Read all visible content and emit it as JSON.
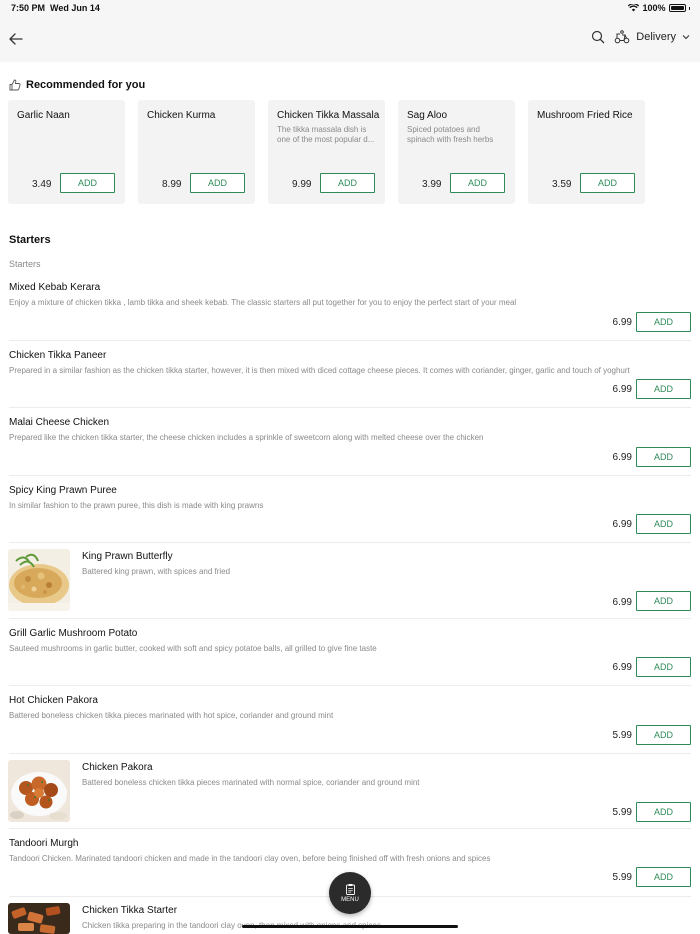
{
  "status": {
    "time": "7:50 PM",
    "date": "Wed Jun 14",
    "battery": "100%"
  },
  "nav": {
    "delivery_label": "Delivery"
  },
  "recommended": {
    "title": "Recommended for you",
    "items": [
      {
        "name": "Garlic Naan",
        "desc": "",
        "price": "3.49",
        "add": "ADD"
      },
      {
        "name": "Chicken Kurma",
        "desc": "",
        "price": "8.99",
        "add": "ADD"
      },
      {
        "name": "Chicken Tikka Massala",
        "desc": "The tikka massala dish is one of the most popular d...",
        "price": "9.99",
        "add": "ADD"
      },
      {
        "name": "Sag Aloo",
        "desc": "Spiced potatoes and spinach with fresh herbs",
        "price": "3.99",
        "add": "ADD"
      },
      {
        "name": "Mushroom Fried Rice",
        "desc": "",
        "price": "3.59",
        "add": "ADD"
      }
    ]
  },
  "starters": {
    "title": "Starters",
    "subtitle": "Starters",
    "items": [
      {
        "name": "Mixed Kebab Kerara",
        "desc": "Enjoy a mixture of chicken tikka , lamb tikka and sheek kebab. The classic starters all put together for you to enjoy the perfect start of your meal",
        "price": "6.99",
        "add": "ADD"
      },
      {
        "name": "Chicken Tikka Paneer",
        "desc": "Prepared in a similar fashion as the chicken tikka starter, however, it is then mixed with diced cottage cheese pieces. It comes with coriander, ginger, garlic and touch of yoghurt",
        "price": "6.99",
        "add": "ADD"
      },
      {
        "name": "Malai Cheese Chicken",
        "desc": "Prepared like the chicken tikka starter, the cheese chicken includes a sprinkle of sweetcorn along with melted cheese over the chicken",
        "price": "6.99",
        "add": "ADD"
      },
      {
        "name": "Spicy King Prawn Puree",
        "desc": "In similar fashion to the prawn puree, this dish is made with king prawns",
        "price": "6.99",
        "add": "ADD"
      },
      {
        "name": "King Prawn Butterfly",
        "desc": "Battered king prawn, with spices and fried",
        "price": "6.99",
        "add": "ADD"
      },
      {
        "name": "Grill Garlic Mushroom Potato",
        "desc": "Sauteed mushrooms in garlic butter, cooked with soft and spicy potatoe balls, all grilled to give fine taste",
        "price": "6.99",
        "add": "ADD"
      },
      {
        "name": "Hot Chicken Pakora",
        "desc": "Battered boneless chicken tikka pieces marinated with hot spice, coriander and ground mint",
        "price": "5.99",
        "add": "ADD"
      },
      {
        "name": "Chicken Pakora",
        "desc": "Battered boneless chicken tikka pieces marinated with normal spice, coriander and ground mint",
        "price": "5.99",
        "add": "ADD"
      },
      {
        "name": "Tandoori Murgh",
        "desc": "Tandoori Chicken. Marinated tandoori chicken and made in the tandoori clay oven, before being finished off with fresh onions and spices",
        "price": "5.99",
        "add": "ADD"
      },
      {
        "name": "Chicken Tikka Starter",
        "desc": "Chicken tikka preparing in the tandoori clay oven, then mixed with onions and spices"
      }
    ]
  },
  "menu_button": {
    "label": "MENU"
  },
  "colors": {
    "accent": "#2e8b57",
    "text_muted": "#8a8a8a",
    "nav_bg": "#f6f6f6",
    "card_bg": "#f3f3f3"
  }
}
